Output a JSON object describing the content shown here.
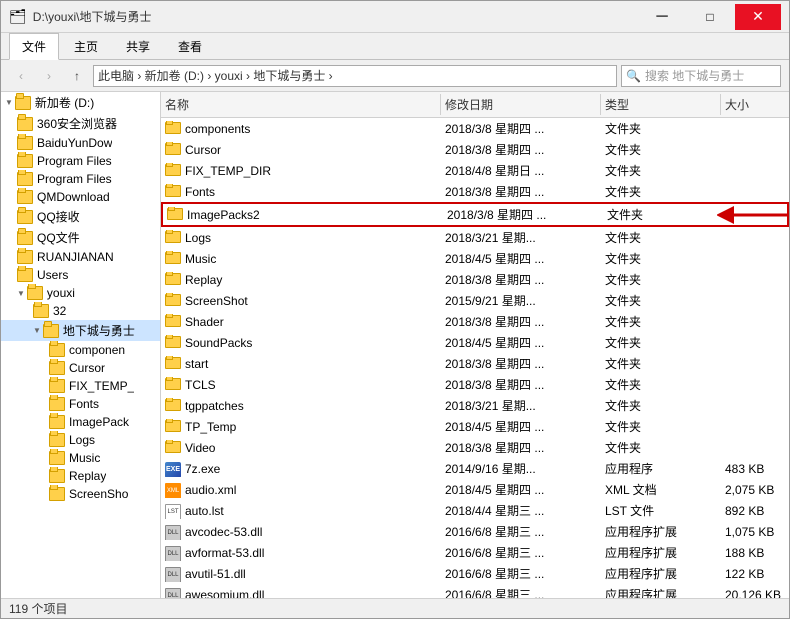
{
  "titleBar": {
    "title": "D:\\youxi\\地下城与勇士",
    "icons": [
      "minimize",
      "maximize",
      "close"
    ]
  },
  "ribbon": {
    "tabs": [
      "文件",
      "主页",
      "共享",
      "查看"
    ],
    "activeTab": "主页"
  },
  "addressBar": {
    "breadcrumb": "此电脑 › 新加卷 (D:) › youxi › 地下城与勇士 ›",
    "searchPlaceholder": "搜索 地下城与勇士"
  },
  "sidebar": {
    "items": [
      {
        "label": "新加卷 (D:)",
        "level": 0,
        "expanded": true
      },
      {
        "label": "360安全浏览器",
        "level": 1
      },
      {
        "label": "BaiduYunDow",
        "level": 1
      },
      {
        "label": "Program Files",
        "level": 1
      },
      {
        "label": "Program Files",
        "level": 1
      },
      {
        "label": "QMDownload",
        "level": 1
      },
      {
        "label": "QQ接收",
        "level": 1
      },
      {
        "label": "QQ文件",
        "level": 1
      },
      {
        "label": "RUANJIANAN",
        "level": 1
      },
      {
        "label": "Users",
        "level": 1
      },
      {
        "label": "youxi",
        "level": 1,
        "expanded": true
      },
      {
        "label": "32",
        "level": 2
      },
      {
        "label": "地下城与勇士",
        "level": 2,
        "selected": true,
        "expanded": true
      },
      {
        "label": "componen",
        "level": 3
      },
      {
        "label": "Cursor",
        "level": 3
      },
      {
        "label": "FIX_TEMP_",
        "level": 3
      },
      {
        "label": "Fonts",
        "level": 3
      },
      {
        "label": "ImagePack",
        "level": 3
      },
      {
        "label": "Logs",
        "level": 3
      },
      {
        "label": "Music",
        "level": 3
      },
      {
        "label": "Replay",
        "level": 3
      },
      {
        "label": "ScreenSho",
        "level": 3
      }
    ]
  },
  "fileList": {
    "headers": [
      "名称",
      "修改日期",
      "类型",
      "大小"
    ],
    "files": [
      {
        "name": "components",
        "date": "2018/3/8 星期四 ...",
        "type": "文件夹",
        "size": "",
        "isFolder": true
      },
      {
        "name": "Cursor",
        "date": "2018/3/8 星期四 ...",
        "type": "文件夹",
        "size": "",
        "isFolder": true
      },
      {
        "name": "FIX_TEMP_DIR",
        "date": "2018/4/8 星期日 ...",
        "type": "文件夹",
        "size": "",
        "isFolder": true
      },
      {
        "name": "Fonts",
        "date": "2018/3/8 星期四 ...",
        "type": "文件夹",
        "size": "",
        "isFolder": true
      },
      {
        "name": "ImagePacks2",
        "date": "2018/3/8 星期四 ...",
        "type": "文件夹",
        "size": "",
        "isFolder": true,
        "highlighted": true
      },
      {
        "name": "Logs",
        "date": "2018/3/21 星期...",
        "type": "文件夹",
        "size": "",
        "isFolder": true
      },
      {
        "name": "Music",
        "date": "2018/4/5 星期四 ...",
        "type": "文件夹",
        "size": "",
        "isFolder": true
      },
      {
        "name": "Replay",
        "date": "2018/3/8 星期四 ...",
        "type": "文件夹",
        "size": "",
        "isFolder": true
      },
      {
        "name": "ScreenShot",
        "date": "2015/9/21 星期...",
        "type": "文件夹",
        "size": "",
        "isFolder": true
      },
      {
        "name": "Shader",
        "date": "2018/3/8 星期四 ...",
        "type": "文件夹",
        "size": "",
        "isFolder": true
      },
      {
        "name": "SoundPacks",
        "date": "2018/4/5 星期四 ...",
        "type": "文件夹",
        "size": "",
        "isFolder": true
      },
      {
        "name": "start",
        "date": "2018/3/8 星期四 ...",
        "type": "文件夹",
        "size": "",
        "isFolder": true
      },
      {
        "name": "TCLS",
        "date": "2018/3/8 星期四 ...",
        "type": "文件夹",
        "size": "",
        "isFolder": true
      },
      {
        "name": "tgppatches",
        "date": "2018/3/21 星期...",
        "type": "文件夹",
        "size": "",
        "isFolder": true
      },
      {
        "name": "TP_Temp",
        "date": "2018/4/5 星期四 ...",
        "type": "文件夹",
        "size": "",
        "isFolder": true
      },
      {
        "name": "Video",
        "date": "2018/3/8 星期四 ...",
        "type": "文件夹",
        "size": "",
        "isFolder": true
      },
      {
        "name": "7z.exe",
        "date": "2014/9/16 星期...",
        "type": "应用程序",
        "size": "483 KB",
        "isFolder": false,
        "iconType": "exe"
      },
      {
        "name": "audio.xml",
        "date": "2018/4/5 星期四 ...",
        "type": "XML 文档",
        "size": "2,075 KB",
        "isFolder": false,
        "iconType": "xml"
      },
      {
        "name": "auto.lst",
        "date": "2018/4/4 星期三 ...",
        "type": "LST 文件",
        "size": "892 KB",
        "isFolder": false,
        "iconType": "lst"
      },
      {
        "name": "avcodec-53.dll",
        "date": "2016/6/8 星期三 ...",
        "type": "应用程序扩展",
        "size": "1,075 KB",
        "isFolder": false,
        "iconType": "dll"
      },
      {
        "name": "avformat-53.dll",
        "date": "2016/6/8 星期三 ...",
        "type": "应用程序扩展",
        "size": "188 KB",
        "isFolder": false,
        "iconType": "dll"
      },
      {
        "name": "avutil-51.dll",
        "date": "2016/6/8 星期三 ...",
        "type": "应用程序扩展",
        "size": "122 KB",
        "isFolder": false,
        "iconType": "dll"
      },
      {
        "name": "awesomium.dll",
        "date": "2016/6/8 星期三 ...",
        "type": "应用程序扩展",
        "size": "20,126 KB",
        "isFolder": false,
        "iconType": "dll"
      }
    ]
  },
  "statusBar": {
    "text": "119 个项目"
  }
}
